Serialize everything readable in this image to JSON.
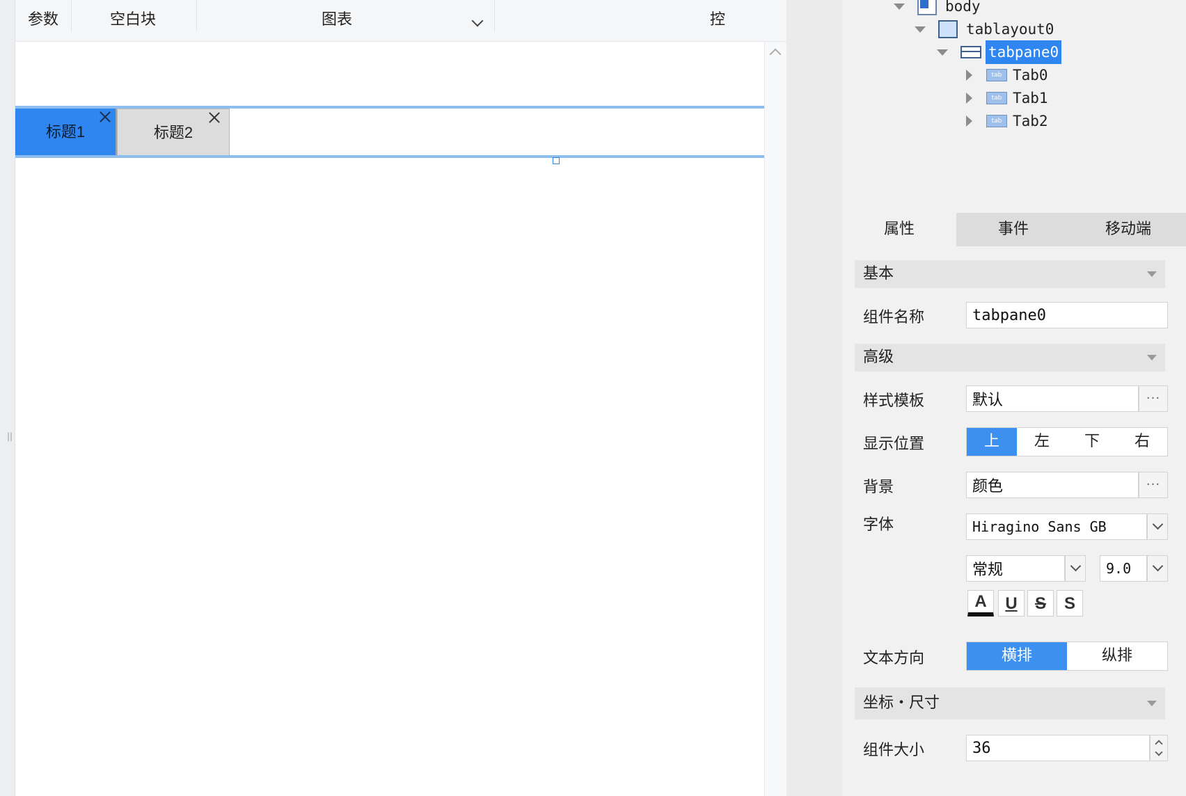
{
  "toolbar": {
    "items": [
      "参数",
      "空白块",
      "图表",
      "控"
    ]
  },
  "canvas": {
    "tabs": [
      {
        "label": "标题1",
        "active": true
      },
      {
        "label": "标题2",
        "active": false
      }
    ]
  },
  "tree": {
    "nodes": [
      {
        "label": "body",
        "icon": "body-icon",
        "expanded": true
      },
      {
        "label": "tablayout0",
        "icon": "table-layout-icon",
        "expanded": true
      },
      {
        "label": "tabpane0",
        "icon": "tab-pane-icon",
        "expanded": true,
        "selected": true
      },
      {
        "label": "Tab0",
        "icon": "tab-icon",
        "expanded": false
      },
      {
        "label": "Tab1",
        "icon": "tab-icon",
        "expanded": false
      },
      {
        "label": "Tab2",
        "icon": "tab-icon",
        "expanded": false
      }
    ],
    "tab_icon_text": "tab"
  },
  "panel": {
    "tabs": [
      "属性",
      "事件",
      "移动端"
    ],
    "active_tab": "属性",
    "sections": {
      "basic": "基本",
      "advanced": "高级",
      "position_size": "坐标・尺寸"
    },
    "fields": {
      "component_name": {
        "label": "组件名称",
        "value": "tabpane0"
      },
      "style_template": {
        "label": "样式模板",
        "value": "默认"
      },
      "display_position": {
        "label": "显示位置",
        "options": [
          "上",
          "左",
          "下",
          "右"
        ],
        "selected": "上"
      },
      "background": {
        "label": "背景",
        "value": "颜色"
      },
      "font": {
        "label": "字体",
        "family": "Hiragino Sans GB",
        "weight": "常规",
        "size": "9.0"
      },
      "text_direction": {
        "label": "文本方向",
        "options": [
          "横排",
          "纵排"
        ],
        "selected": "横排"
      },
      "component_size": {
        "label": "组件大小",
        "value": "36"
      }
    },
    "format_buttons": [
      "A",
      "U",
      "S",
      "S"
    ],
    "ellipsis": "···"
  },
  "colors": {
    "accent": "#2f86f0",
    "tab_line": "#8dbcef",
    "panel_bg": "#f1f1f1"
  }
}
